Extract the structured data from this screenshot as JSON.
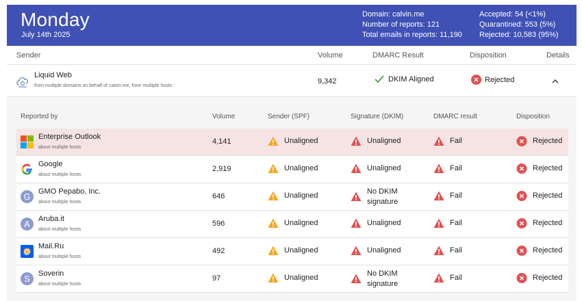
{
  "header": {
    "day": "Monday",
    "date": "July 14th 2025",
    "domain": "Domain: calvin.me",
    "reports": "Number of reports: 121",
    "total": "Total emails in reports: 11,190",
    "accepted": "Accepted: 54 (<1%)",
    "quarantined": "Quarantined: 553 (5%)",
    "rejected": "Rejected: 10,583 (95%)"
  },
  "columns": {
    "sender": "Sender",
    "volume": "Volume",
    "dmarc": "DMARC Result",
    "disposition": "Disposition",
    "details": "Details"
  },
  "sender": {
    "name": "Liquid Web",
    "sub": "from multiple domains on behalf of calvin.me, from multiple hosts",
    "volume": "9,342",
    "dmarc": "DKIM Aligned",
    "disposition": "Rejected"
  },
  "inner_columns": {
    "reported_by": "Reported by",
    "volume": "Volume",
    "spf": "Sender (SPF)",
    "dkim": "Signature (DKIM)",
    "dmarc": "DMARC result",
    "disposition": "Disposition"
  },
  "reports": [
    {
      "name": "Enterprise Outlook",
      "sub": "about multiple hosts",
      "volume": "4,141",
      "spf": "Unaligned",
      "dkim": "Unaligned",
      "dmarc": "Fail",
      "disposition": "Rejected",
      "logo": "microsoft-logo"
    },
    {
      "name": "Google",
      "sub": "about multiple hosts",
      "volume": "2,919",
      "spf": "Unaligned",
      "dkim": "Unaligned",
      "dmarc": "Fail",
      "disposition": "Rejected",
      "logo": "google-logo"
    },
    {
      "name": "GMO Pepabo, Inc.",
      "sub": "about multiple hosts",
      "volume": "646",
      "spf": "Unaligned",
      "dkim": "No DKIM signature",
      "dmarc": "Fail",
      "disposition": "Rejected",
      "logo": "letter-g-avatar"
    },
    {
      "name": "Aruba.it",
      "sub": "about multiple hosts",
      "volume": "596",
      "spf": "Unaligned",
      "dkim": "Unaligned",
      "dmarc": "Fail",
      "disposition": "Rejected",
      "logo": "letter-a-avatar"
    },
    {
      "name": "Mail.Ru",
      "sub": "about multiple hosts",
      "volume": "492",
      "spf": "Unaligned",
      "dkim": "Unaligned",
      "dmarc": "Fail",
      "disposition": "Rejected",
      "logo": "mailru-logo"
    },
    {
      "name": "Soverin",
      "sub": "about multiple hosts",
      "volume": "97",
      "spf": "Unaligned",
      "dkim": "No DKIM signature",
      "dmarc": "Fail",
      "disposition": "Rejected",
      "logo": "letter-s-avatar"
    }
  ],
  "colors": {
    "header_bg": "#3f51b5",
    "warning": "#f5a623",
    "error": "#e05252",
    "success": "#43a047",
    "highlight_row": "#f6e4e5"
  }
}
